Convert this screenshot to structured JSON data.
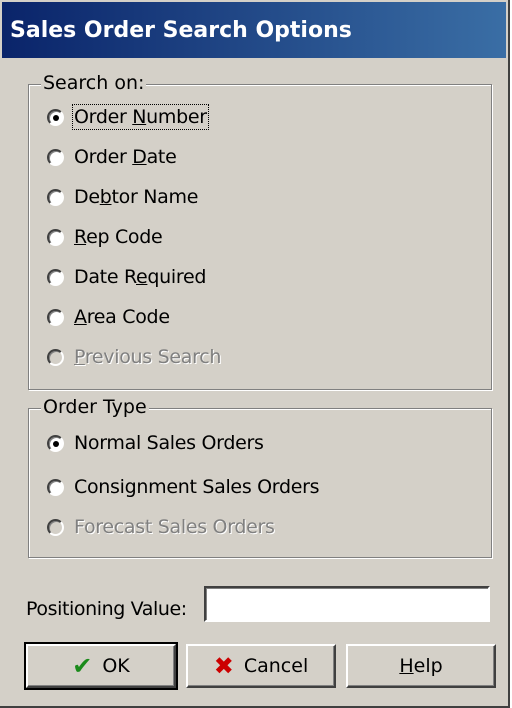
{
  "window": {
    "title": "Sales Order Search Options"
  },
  "search_on": {
    "legend": "Search on:",
    "options": [
      {
        "pre": "Order ",
        "key": "N",
        "post": "umber",
        "selected": true,
        "disabled": false,
        "focused": true
      },
      {
        "pre": "Order ",
        "key": "D",
        "post": "ate",
        "selected": false,
        "disabled": false,
        "focused": false
      },
      {
        "pre": "De",
        "key": "b",
        "post": "tor Name",
        "selected": false,
        "disabled": false,
        "focused": false
      },
      {
        "pre": "",
        "key": "R",
        "post": "ep Code",
        "selected": false,
        "disabled": false,
        "focused": false
      },
      {
        "pre": "Date R",
        "key": "e",
        "post": "quired",
        "selected": false,
        "disabled": false,
        "focused": false
      },
      {
        "pre": "",
        "key": "A",
        "post": "rea Code",
        "selected": false,
        "disabled": false,
        "focused": false
      },
      {
        "pre": "",
        "key": "P",
        "post": "revious Search",
        "selected": false,
        "disabled": true,
        "focused": false
      }
    ]
  },
  "order_type": {
    "legend": "Order Type",
    "options": [
      {
        "pre": "Normal Sales Orders",
        "key": "",
        "post": "",
        "selected": true,
        "disabled": false,
        "focused": false
      },
      {
        "pre": "Consignment Sales Orders",
        "key": "",
        "post": "",
        "selected": false,
        "disabled": false,
        "focused": false
      },
      {
        "pre": "Forecast Sales Orders",
        "key": "",
        "post": "",
        "selected": false,
        "disabled": true,
        "focused": false
      }
    ]
  },
  "positioning": {
    "label": "Positioning Value:",
    "value": ""
  },
  "buttons": {
    "ok": {
      "label": "OK",
      "icon": "checkmark-icon"
    },
    "cancel": {
      "label": "Cancel",
      "icon": "x-icon"
    },
    "help": {
      "key": "H",
      "rest": "elp"
    }
  },
  "colors": {
    "dialog_bg": "#d4d0c8",
    "title_bg": "#0a246a",
    "ok_icon": "#1a8a1a",
    "cancel_icon": "#cc0000"
  }
}
